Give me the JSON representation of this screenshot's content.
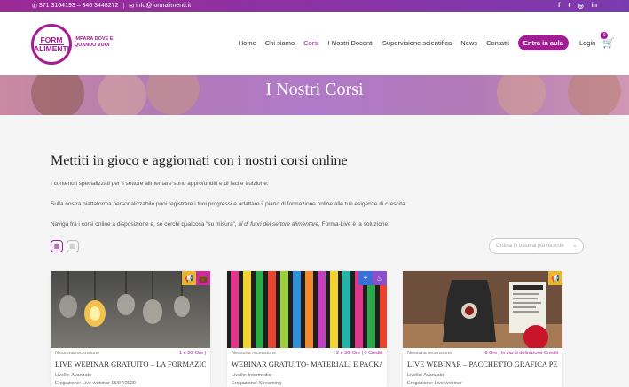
{
  "topbar": {
    "phone": "371 3164193 – 340 3448272",
    "email": "info@formalimenti.it",
    "socials": [
      "f",
      "t",
      "◎",
      "in"
    ]
  },
  "header": {
    "logo_line1": "FORM",
    "logo_line2": "ALIMENTI",
    "tagline": "IMPARA DOVE E QUANDO VUOI",
    "nav": [
      "Home",
      "Chi siamo",
      "Corsi",
      "I Nostri Docenti",
      "Supervisione scientifica",
      "News",
      "Contatti"
    ],
    "active_nav": "Corsi",
    "cta_label": "Entra in aula",
    "login_label": "Login",
    "cart_count": "0",
    "brand_color": "#a21c93"
  },
  "hero": {
    "title": "I Nostri Corsi"
  },
  "main": {
    "heading": "Mettiti in gioco e aggiornati con i nostri corsi online",
    "para1": "I contenuti specializzati per il settore alimentare sono approfonditi e di facile fruizione.",
    "para2": "Sulla nostra piattaforma personalizzabile puoi registrare i tuoi progressi e adattare il piano di formazione online alle tue esigenze di crescita.",
    "para3_a": "Naviga fra i corsi online a disposizione e, se cerchi qualcosa “su misura”,",
    "para3_em": "al di fuori del settore alimentare,",
    "para3_b": "Forma-Live è la soluzione.",
    "sort_placeholder": "Ordina in base al più recente"
  },
  "cards": [
    {
      "review": "Nessuna recensione",
      "info": "1 e 30' Ore |",
      "title": "LIVE WEBINAR GRATUITO – LA FORMAZIO...",
      "level": "Livello: Avanzato",
      "delivery": "Erogazione: Live webinar 15/07/2020",
      "icons": [
        "megaphone-icon",
        "briefcase-icon"
      ]
    },
    {
      "review": "Nessuna recensione",
      "info": "2 e 30' Ore | 0 Crediti",
      "title": "WEBINAR GRATUITO- MATERIALI E PACKA...",
      "level": "Livello: Intermedio",
      "delivery": "Erogazione: Streaming",
      "icons": [
        "crosshair-icon",
        "chef-hat-icon"
      ]
    },
    {
      "review": "Nessuna recensione",
      "info": "8 Ore | In via di definizione Crediti",
      "title": "LIVE WEBINAR – PACCHETTO GRAFICA PE...",
      "level": "Livello: Avanzato",
      "delivery": "Erogazione: Live webinar",
      "icons": [
        "megaphone-icon"
      ]
    }
  ]
}
